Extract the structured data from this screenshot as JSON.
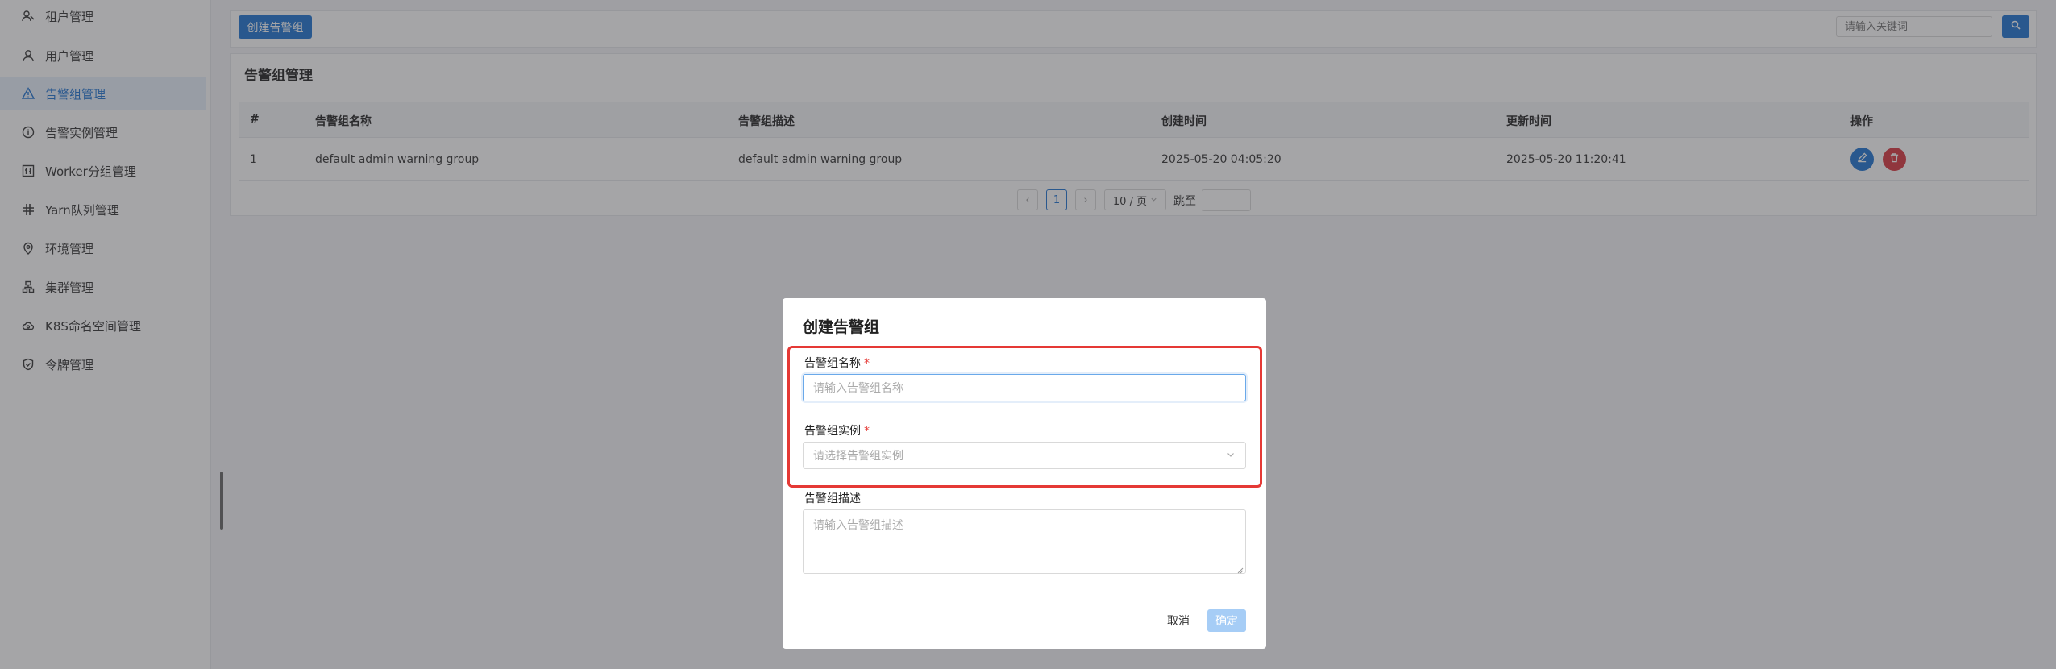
{
  "sidebar": {
    "items": [
      {
        "label": "租户管理",
        "icon": "tenant-icon"
      },
      {
        "label": "用户管理",
        "icon": "user-icon"
      },
      {
        "label": "告警组管理",
        "icon": "warning-triangle-icon",
        "active": true
      },
      {
        "label": "告警实例管理",
        "icon": "info-circle-icon"
      },
      {
        "label": "Worker分组管理",
        "icon": "worker-group-icon"
      },
      {
        "label": "Yarn队列管理",
        "icon": "queue-icon"
      },
      {
        "label": "环境管理",
        "icon": "location-pin-icon"
      },
      {
        "label": "集群管理",
        "icon": "cluster-icon"
      },
      {
        "label": "K8S命名空间管理",
        "icon": "cloud-icon"
      },
      {
        "label": "令牌管理",
        "icon": "shield-check-icon"
      }
    ]
  },
  "toolbar": {
    "create_label": "创建告警组",
    "search_placeholder": "请输入关键词"
  },
  "panel": {
    "title": "告警组管理"
  },
  "table": {
    "columns": [
      "#",
      "告警组名称",
      "告警组描述",
      "创建时间",
      "更新时间",
      "操作"
    ],
    "rows": [
      [
        "1",
        "default admin warning group",
        "default admin warning group",
        "2025-05-20 04:05:20",
        "2025-05-20 11:20:41"
      ]
    ]
  },
  "pagination": {
    "prev": "‹",
    "current": "1",
    "next": "›",
    "page_size": "10 / 页",
    "jump_label": "跳至"
  },
  "modal": {
    "title": "创建告警组",
    "name_label": "告警组名称",
    "name_placeholder": "请输入告警组名称",
    "instance_label": "告警组实例",
    "instance_placeholder": "请选择告警组实例",
    "desc_label": "告警组描述",
    "desc_placeholder": "请输入告警组描述",
    "required_mark": "*",
    "cancel_label": "取消",
    "ok_label": "确定"
  },
  "colors": {
    "primary": "#1e73d2",
    "danger": "#d9363e",
    "highlight": "#e53935"
  }
}
